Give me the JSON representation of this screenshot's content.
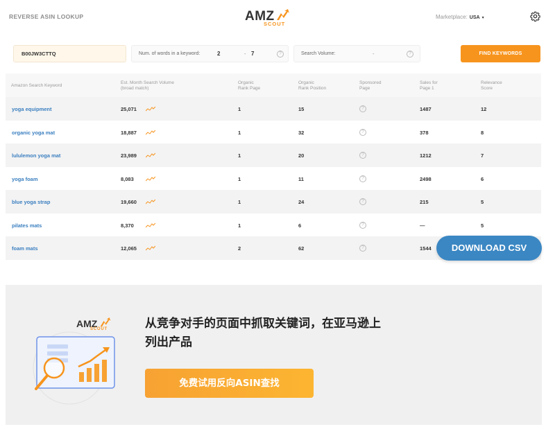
{
  "header": {
    "title": "REVERSE ASIN LOOKUP",
    "logo_main": "AMZ",
    "logo_sub": "SCOUT",
    "marketplace_label": "Marketplace:",
    "marketplace_value": "USA",
    "caret": "▾"
  },
  "filters": {
    "asin_value": "B00JW3CTTQ",
    "words_label": "Num. of words in a keyword:",
    "words_min": "2",
    "words_max": "7",
    "range_dash": "-",
    "volume_label": "Search Volume:",
    "volume_dash": "-",
    "help_glyph": "?",
    "find_button": "FIND KEYWORDS"
  },
  "table": {
    "headers": {
      "keyword": "Amazon Search Keyword",
      "volume_1": "Est. Month Search Volume",
      "volume_2": "(broad match)",
      "org_page_1": "Organic",
      "org_page_2": "Rank Page",
      "org_pos_1": "Organic",
      "org_pos_2": "Rank Position",
      "sponsored_1": "Sponsored",
      "sponsored_2": "Page",
      "sales_1": "Sales for",
      "sales_2": "Page 1",
      "relevance_1": "Relevance",
      "relevance_2": "Score"
    },
    "rows": [
      {
        "keyword": "yoga equipment",
        "volume": "25,071",
        "org_page": "1",
        "org_pos": "15",
        "sales": "1487",
        "relevance": "12"
      },
      {
        "keyword": "organic yoga mat",
        "volume": "18,887",
        "org_page": "1",
        "org_pos": "32",
        "sales": "378",
        "relevance": "8"
      },
      {
        "keyword": "lululemon yoga mat",
        "volume": "23,989",
        "org_page": "1",
        "org_pos": "20",
        "sales": "1212",
        "relevance": "7"
      },
      {
        "keyword": "yoga foam",
        "volume": "8,083",
        "org_page": "1",
        "org_pos": "11",
        "sales": "2498",
        "relevance": "6"
      },
      {
        "keyword": "blue yoga strap",
        "volume": "19,660",
        "org_page": "1",
        "org_pos": "24",
        "sales": "215",
        "relevance": "5"
      },
      {
        "keyword": "pilates mats",
        "volume": "8,370",
        "org_page": "1",
        "org_pos": "6",
        "sales": "—",
        "relevance": "5"
      },
      {
        "keyword": "foam mats",
        "volume": "12,065",
        "org_page": "2",
        "org_pos": "62",
        "sales": "1544",
        "relevance": ""
      }
    ],
    "download_button": "DOWNLOAD CSV"
  },
  "promo": {
    "logo_main": "AMZ",
    "logo_sub": "SCOUT",
    "line1": "从竞争对手的页面中抓取关键词，在亚马逊上",
    "line2": "列出产品",
    "button": "免费试用反向ASIN查找"
  },
  "colors": {
    "accent": "#f7941d",
    "link": "#3b7fc0",
    "download": "#3b87c3"
  }
}
